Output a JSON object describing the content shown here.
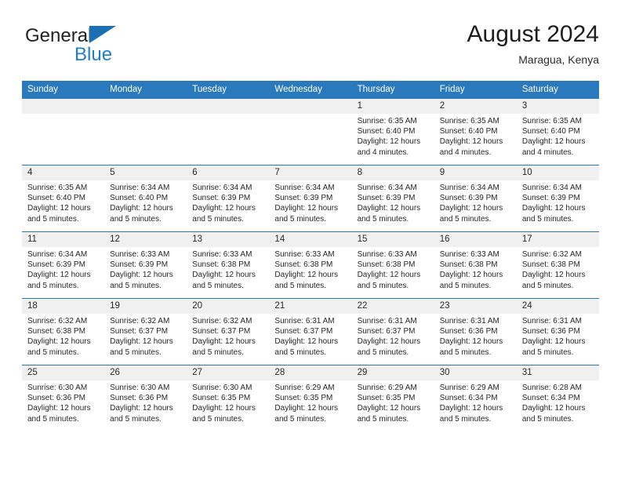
{
  "brand": {
    "name_part1": "General",
    "name_part2": "Blue",
    "triangle_color": "#1b6fb5",
    "blue_color": "#1d7fd0"
  },
  "header": {
    "title": "August 2024",
    "subtitle": "Maragua, Kenya"
  },
  "theme": {
    "header_bg": "#2b79bd",
    "daynum_bg": "#f0f0f0",
    "row_border": "#2b79bd"
  },
  "weekdays": [
    "Sunday",
    "Monday",
    "Tuesday",
    "Wednesday",
    "Thursday",
    "Friday",
    "Saturday"
  ],
  "labels": {
    "sunrise_prefix": "Sunrise: ",
    "sunset_prefix": "Sunset: ",
    "daylight_prefix": "Daylight: "
  },
  "weeks": [
    [
      {
        "day": "",
        "empty": true
      },
      {
        "day": "",
        "empty": true
      },
      {
        "day": "",
        "empty": true
      },
      {
        "day": "",
        "empty": true
      },
      {
        "day": "1",
        "sunrise": "Sunrise: 6:35 AM",
        "sunset": "Sunset: 6:40 PM",
        "daylight_line1": "Daylight: 12 hours",
        "daylight_line2": "and 4 minutes."
      },
      {
        "day": "2",
        "sunrise": "Sunrise: 6:35 AM",
        "sunset": "Sunset: 6:40 PM",
        "daylight_line1": "Daylight: 12 hours",
        "daylight_line2": "and 4 minutes."
      },
      {
        "day": "3",
        "sunrise": "Sunrise: 6:35 AM",
        "sunset": "Sunset: 6:40 PM",
        "daylight_line1": "Daylight: 12 hours",
        "daylight_line2": "and 4 minutes."
      }
    ],
    [
      {
        "day": "4",
        "sunrise": "Sunrise: 6:35 AM",
        "sunset": "Sunset: 6:40 PM",
        "daylight_line1": "Daylight: 12 hours",
        "daylight_line2": "and 5 minutes."
      },
      {
        "day": "5",
        "sunrise": "Sunrise: 6:34 AM",
        "sunset": "Sunset: 6:40 PM",
        "daylight_line1": "Daylight: 12 hours",
        "daylight_line2": "and 5 minutes."
      },
      {
        "day": "6",
        "sunrise": "Sunrise: 6:34 AM",
        "sunset": "Sunset: 6:39 PM",
        "daylight_line1": "Daylight: 12 hours",
        "daylight_line2": "and 5 minutes."
      },
      {
        "day": "7",
        "sunrise": "Sunrise: 6:34 AM",
        "sunset": "Sunset: 6:39 PM",
        "daylight_line1": "Daylight: 12 hours",
        "daylight_line2": "and 5 minutes."
      },
      {
        "day": "8",
        "sunrise": "Sunrise: 6:34 AM",
        "sunset": "Sunset: 6:39 PM",
        "daylight_line1": "Daylight: 12 hours",
        "daylight_line2": "and 5 minutes."
      },
      {
        "day": "9",
        "sunrise": "Sunrise: 6:34 AM",
        "sunset": "Sunset: 6:39 PM",
        "daylight_line1": "Daylight: 12 hours",
        "daylight_line2": "and 5 minutes."
      },
      {
        "day": "10",
        "sunrise": "Sunrise: 6:34 AM",
        "sunset": "Sunset: 6:39 PM",
        "daylight_line1": "Daylight: 12 hours",
        "daylight_line2": "and 5 minutes."
      }
    ],
    [
      {
        "day": "11",
        "sunrise": "Sunrise: 6:34 AM",
        "sunset": "Sunset: 6:39 PM",
        "daylight_line1": "Daylight: 12 hours",
        "daylight_line2": "and 5 minutes."
      },
      {
        "day": "12",
        "sunrise": "Sunrise: 6:33 AM",
        "sunset": "Sunset: 6:39 PM",
        "daylight_line1": "Daylight: 12 hours",
        "daylight_line2": "and 5 minutes."
      },
      {
        "day": "13",
        "sunrise": "Sunrise: 6:33 AM",
        "sunset": "Sunset: 6:38 PM",
        "daylight_line1": "Daylight: 12 hours",
        "daylight_line2": "and 5 minutes."
      },
      {
        "day": "14",
        "sunrise": "Sunrise: 6:33 AM",
        "sunset": "Sunset: 6:38 PM",
        "daylight_line1": "Daylight: 12 hours",
        "daylight_line2": "and 5 minutes."
      },
      {
        "day": "15",
        "sunrise": "Sunrise: 6:33 AM",
        "sunset": "Sunset: 6:38 PM",
        "daylight_line1": "Daylight: 12 hours",
        "daylight_line2": "and 5 minutes."
      },
      {
        "day": "16",
        "sunrise": "Sunrise: 6:33 AM",
        "sunset": "Sunset: 6:38 PM",
        "daylight_line1": "Daylight: 12 hours",
        "daylight_line2": "and 5 minutes."
      },
      {
        "day": "17",
        "sunrise": "Sunrise: 6:32 AM",
        "sunset": "Sunset: 6:38 PM",
        "daylight_line1": "Daylight: 12 hours",
        "daylight_line2": "and 5 minutes."
      }
    ],
    [
      {
        "day": "18",
        "sunrise": "Sunrise: 6:32 AM",
        "sunset": "Sunset: 6:38 PM",
        "daylight_line1": "Daylight: 12 hours",
        "daylight_line2": "and 5 minutes."
      },
      {
        "day": "19",
        "sunrise": "Sunrise: 6:32 AM",
        "sunset": "Sunset: 6:37 PM",
        "daylight_line1": "Daylight: 12 hours",
        "daylight_line2": "and 5 minutes."
      },
      {
        "day": "20",
        "sunrise": "Sunrise: 6:32 AM",
        "sunset": "Sunset: 6:37 PM",
        "daylight_line1": "Daylight: 12 hours",
        "daylight_line2": "and 5 minutes."
      },
      {
        "day": "21",
        "sunrise": "Sunrise: 6:31 AM",
        "sunset": "Sunset: 6:37 PM",
        "daylight_line1": "Daylight: 12 hours",
        "daylight_line2": "and 5 minutes."
      },
      {
        "day": "22",
        "sunrise": "Sunrise: 6:31 AM",
        "sunset": "Sunset: 6:37 PM",
        "daylight_line1": "Daylight: 12 hours",
        "daylight_line2": "and 5 minutes."
      },
      {
        "day": "23",
        "sunrise": "Sunrise: 6:31 AM",
        "sunset": "Sunset: 6:36 PM",
        "daylight_line1": "Daylight: 12 hours",
        "daylight_line2": "and 5 minutes."
      },
      {
        "day": "24",
        "sunrise": "Sunrise: 6:31 AM",
        "sunset": "Sunset: 6:36 PM",
        "daylight_line1": "Daylight: 12 hours",
        "daylight_line2": "and 5 minutes."
      }
    ],
    [
      {
        "day": "25",
        "sunrise": "Sunrise: 6:30 AM",
        "sunset": "Sunset: 6:36 PM",
        "daylight_line1": "Daylight: 12 hours",
        "daylight_line2": "and 5 minutes."
      },
      {
        "day": "26",
        "sunrise": "Sunrise: 6:30 AM",
        "sunset": "Sunset: 6:36 PM",
        "daylight_line1": "Daylight: 12 hours",
        "daylight_line2": "and 5 minutes."
      },
      {
        "day": "27",
        "sunrise": "Sunrise: 6:30 AM",
        "sunset": "Sunset: 6:35 PM",
        "daylight_line1": "Daylight: 12 hours",
        "daylight_line2": "and 5 minutes."
      },
      {
        "day": "28",
        "sunrise": "Sunrise: 6:29 AM",
        "sunset": "Sunset: 6:35 PM",
        "daylight_line1": "Daylight: 12 hours",
        "daylight_line2": "and 5 minutes."
      },
      {
        "day": "29",
        "sunrise": "Sunrise: 6:29 AM",
        "sunset": "Sunset: 6:35 PM",
        "daylight_line1": "Daylight: 12 hours",
        "daylight_line2": "and 5 minutes."
      },
      {
        "day": "30",
        "sunrise": "Sunrise: 6:29 AM",
        "sunset": "Sunset: 6:34 PM",
        "daylight_line1": "Daylight: 12 hours",
        "daylight_line2": "and 5 minutes."
      },
      {
        "day": "31",
        "sunrise": "Sunrise: 6:28 AM",
        "sunset": "Sunset: 6:34 PM",
        "daylight_line1": "Daylight: 12 hours",
        "daylight_line2": "and 5 minutes."
      }
    ]
  ]
}
